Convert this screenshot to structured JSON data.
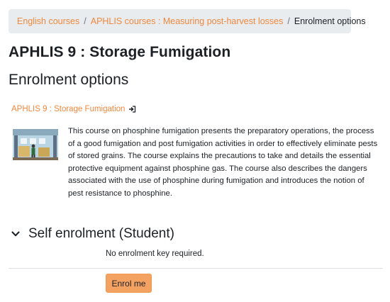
{
  "breadcrumb": {
    "items": [
      {
        "label": "English courses"
      },
      {
        "label": "APHLIS courses : Measuring post-harvest losses"
      }
    ],
    "current": "Enrolment options",
    "separator": "/"
  },
  "course": {
    "title": "APHLIS 9 : Storage Fumigation",
    "link_label": "APHLIS 9 : Storage Fumigation",
    "link_icon": "enter-icon",
    "summary": "This course on phosphine fumigation presents the preparatory operations, the process of a good fumigation and post fumigation activities in order to effectively eliminate pests of stored grains. The course explains the precautions to take and details the essential protective equipment against phosphine gas. The course also describes the dangers associated with the use of phosphine during fumigation and introduces the notion of pest resistance to phosphine."
  },
  "page": {
    "section_title": "Enrolment options"
  },
  "enrolment": {
    "title": "Self enrolment (Student)",
    "toggle_icon": "chevron-down-icon",
    "note": "No enrolment key required.",
    "button_label": "Enrol me"
  },
  "colors": {
    "link": "#f0883e",
    "button": "#f4a261",
    "breadcrumb_bg": "#e9ecef"
  }
}
